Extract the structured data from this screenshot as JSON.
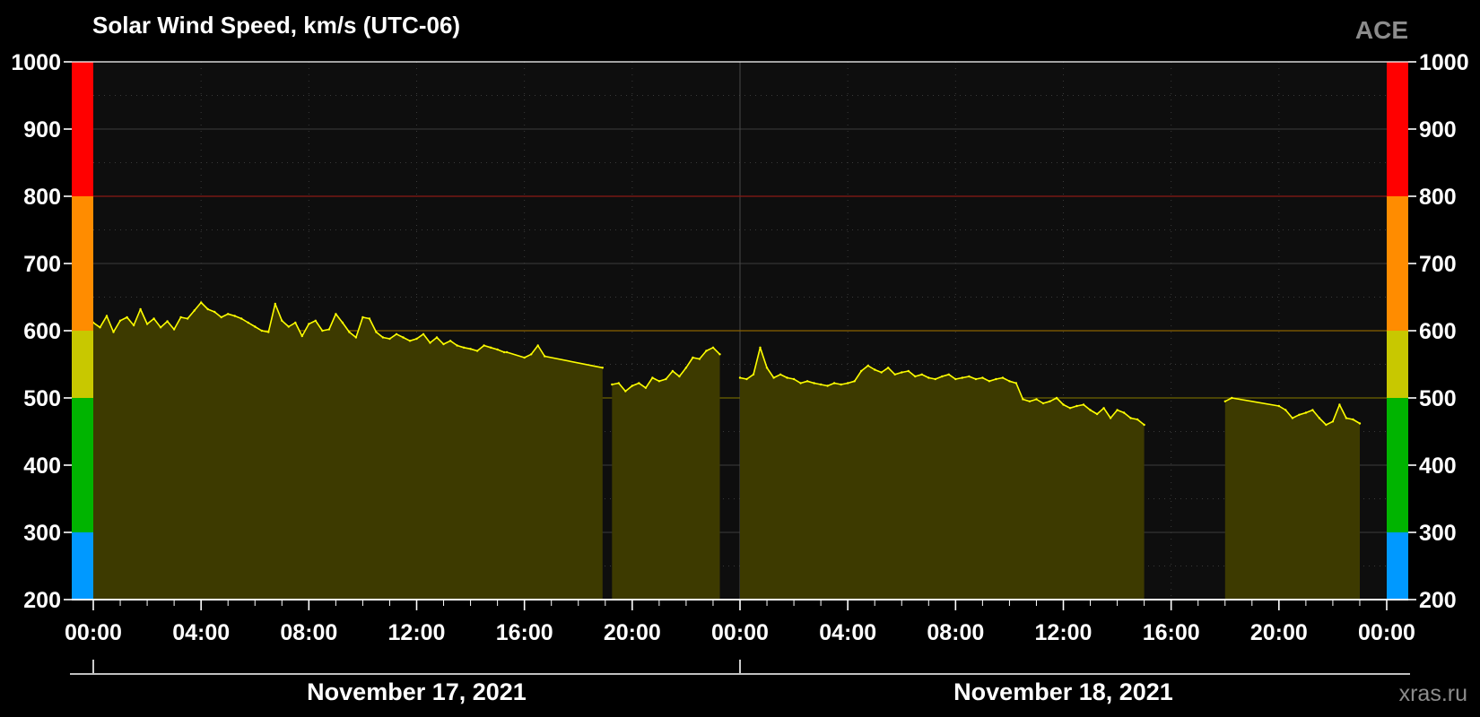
{
  "chart_data": {
    "type": "area",
    "title": "Solar Wind Speed, km/s (UTC-06)",
    "source": "ACE",
    "credit": "xras.ru",
    "xlabel": "",
    "ylabel": "",
    "ylim": [
      200,
      1000
    ],
    "yticks": [
      200,
      300,
      400,
      500,
      600,
      700,
      800,
      900,
      1000
    ],
    "x_range_hours": [
      0,
      48
    ],
    "x_tick_labels": [
      "00:00",
      "04:00",
      "08:00",
      "12:00",
      "16:00",
      "20:00",
      "00:00",
      "04:00",
      "08:00",
      "12:00",
      "16:00",
      "20:00",
      "00:00"
    ],
    "date_labels": [
      {
        "label": "November 17, 2021",
        "center_hour": 12
      },
      {
        "label": "November 18, 2021",
        "center_hour": 36
      }
    ],
    "grid": true,
    "threshold_lines": [
      {
        "value": 500,
        "color": "#6f6400"
      },
      {
        "value": 600,
        "color": "#8a6200"
      },
      {
        "value": 800,
        "color": "#8a1a14"
      }
    ],
    "color_scale": [
      {
        "from": 200,
        "to": 300,
        "color": "#0099ff"
      },
      {
        "from": 300,
        "to": 400,
        "color": "#00b400"
      },
      {
        "from": 400,
        "to": 500,
        "color": "#00b400"
      },
      {
        "from": 500,
        "to": 600,
        "color": "#c8c800"
      },
      {
        "from": 600,
        "to": 800,
        "color": "#ff8c00"
      },
      {
        "from": 800,
        "to": 1000,
        "color": "#ff0000"
      }
    ],
    "series": [
      {
        "line_color": "#ffff00",
        "fill_color": "#3d3a00",
        "hours": [
          0.0,
          0.25,
          0.5,
          0.75,
          1.0,
          1.25,
          1.5,
          1.75,
          2.0,
          2.25,
          2.5,
          2.75,
          3.0,
          3.25,
          3.5,
          3.75,
          4.0,
          4.25,
          4.5,
          4.75,
          5.0,
          5.25,
          5.5,
          5.75,
          6.0,
          6.25,
          6.5,
          6.75,
          7.0,
          7.25,
          7.5,
          7.75,
          8.0,
          8.25,
          8.5,
          8.75,
          9.0,
          9.25,
          9.5,
          9.75,
          10.0,
          10.25,
          10.5,
          10.75,
          11.0,
          11.25,
          11.5,
          11.75,
          12.0,
          12.25,
          12.5,
          12.75,
          13.0,
          13.25,
          13.5,
          13.75,
          14.0,
          14.25,
          14.5,
          14.75,
          15.0,
          15.25,
          15.35,
          16.0,
          16.25,
          16.5,
          16.75,
          18.9,
          19.0,
          19.25,
          19.5,
          19.75,
          20.0,
          20.25,
          20.5,
          20.75,
          21.0,
          21.25,
          21.5,
          21.75,
          22.0,
          22.25,
          22.5,
          22.75,
          23.0,
          23.25,
          23.5,
          23.75,
          24.0,
          24.25,
          24.5,
          24.75,
          25.0,
          25.25,
          25.5,
          25.75,
          26.0,
          26.25,
          26.5,
          26.75,
          27.0,
          27.25,
          27.5,
          27.75,
          28.0,
          28.25,
          28.5,
          28.75,
          29.0,
          29.25,
          29.5,
          29.75,
          30.0,
          30.25,
          30.5,
          30.75,
          31.0,
          31.25,
          31.5,
          31.75,
          32.0,
          32.25,
          32.5,
          32.75,
          33.0,
          33.25,
          33.5,
          33.75,
          34.0,
          34.25,
          34.5,
          34.75,
          35.0,
          35.25,
          35.5,
          35.75,
          36.0,
          36.25,
          36.5,
          36.75,
          37.0,
          37.25,
          37.5,
          37.75,
          38.0,
          38.25,
          38.5,
          38.75,
          39.0,
          39.25,
          39.5,
          39.75,
          40.0,
          40.25,
          40.5,
          40.75,
          41.0,
          41.25,
          41.5,
          41.75,
          42.0,
          42.25,
          44.0,
          44.25,
          44.5,
          44.75,
          45.0,
          45.25,
          45.5,
          45.75,
          46.0,
          46.25,
          46.5,
          46.75,
          47.0,
          47.25,
          47.5,
          47.75,
          47.95
        ],
        "values": [
          612,
          605,
          622,
          598,
          615,
          620,
          608,
          632,
          610,
          618,
          605,
          614,
          602,
          620,
          618,
          630,
          642,
          632,
          628,
          620,
          625,
          622,
          618,
          612,
          606,
          600,
          598,
          640,
          615,
          606,
          612,
          592,
          610,
          615,
          600,
          602,
          625,
          612,
          598,
          590,
          620,
          618,
          598,
          590,
          588,
          595,
          590,
          585,
          588,
          595,
          582,
          590,
          580,
          585,
          578,
          575,
          573,
          570,
          578,
          575,
          572,
          568,
          568,
          560,
          565,
          578,
          562,
          545,
          null,
          520,
          522,
          510,
          518,
          522,
          515,
          530,
          525,
          528,
          540,
          532,
          545,
          560,
          558,
          570,
          575,
          565,
          null,
          null,
          530,
          528,
          535,
          575,
          545,
          530,
          535,
          530,
          528,
          522,
          525,
          522,
          520,
          518,
          522,
          520,
          522,
          525,
          540,
          548,
          542,
          538,
          545,
          535,
          538,
          540,
          532,
          535,
          530,
          528,
          532,
          535,
          528,
          530,
          532,
          528,
          530,
          525,
          528,
          530,
          525,
          522,
          498,
          495,
          498,
          492,
          495,
          500,
          490,
          485,
          488,
          490,
          482,
          476,
          485,
          470,
          482,
          478,
          470,
          468,
          460,
          null,
          null,
          null,
          null,
          null,
          null,
          null,
          null,
          null,
          null,
          null,
          495,
          500,
          488,
          482,
          470,
          475,
          478,
          482,
          470,
          460,
          465,
          490,
          470,
          468,
          462
        ]
      }
    ]
  }
}
